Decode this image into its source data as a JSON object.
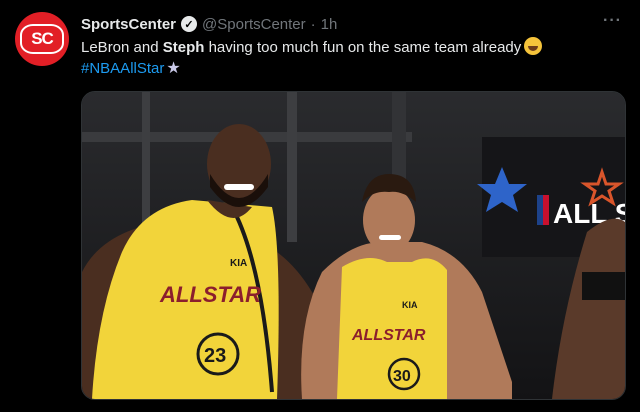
{
  "tweet": {
    "account_name": "SportsCenter",
    "handle": "@SportsCenter",
    "separator": "·",
    "time": "1h",
    "more_label": "···",
    "text_part1": "LeBron and ",
    "text_bold": "Steph",
    "text_part2": " having too much fun on the same team already",
    "hashtag": "#NBAAllStar",
    "avatar_text": "SC"
  },
  "media": {
    "banner_text": "ALL S",
    "jersey_left": {
      "text": "ALLSTAR",
      "number": "23",
      "sponsor": "KIA"
    },
    "jersey_right": {
      "text": "ALLSTAR",
      "number": "30",
      "sponsor": "KIA"
    }
  },
  "icons": [
    "verified-badge-icon",
    "grinning-emoji-icon",
    "star-emoji-icon",
    "more-options-icon"
  ],
  "colors": {
    "background": "#000000",
    "text": "#e7e9ea",
    "muted": "#71767b",
    "link": "#1d9bf0",
    "brand_red": "#e21f26",
    "jersey_yellow": "#f2d43a"
  }
}
